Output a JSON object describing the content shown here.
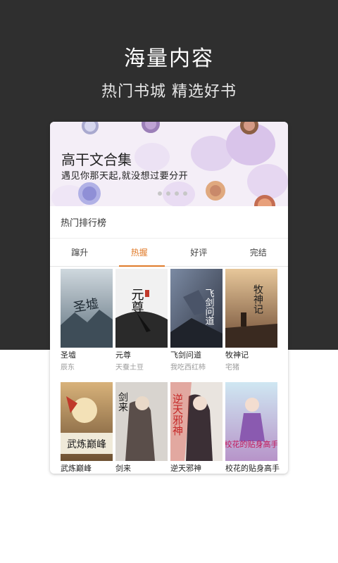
{
  "hero": {
    "title": "海量内容",
    "subtitle": "热门书城  精选好书"
  },
  "banner": {
    "title": "高干文合集",
    "subtitle": "遇见你那天起,就没想过要分开"
  },
  "ranking": {
    "section_title": "热门排行榜",
    "tabs": [
      {
        "label": "蹿升"
      },
      {
        "label": "热握"
      },
      {
        "label": "好评"
      },
      {
        "label": "完结"
      }
    ],
    "active_tab": "热握",
    "accent_color": "#e07b2a"
  },
  "books": [
    {
      "title": "圣墟",
      "author": "辰东",
      "cover_text": "圣墟"
    },
    {
      "title": "元尊",
      "author": "天蚕土豆",
      "cover_text": "元尊"
    },
    {
      "title": "飞剑问道",
      "author": "我吃西红柿",
      "cover_text": "飞剑问道"
    },
    {
      "title": "牧神记",
      "author": "宅猪",
      "cover_text": "牧神记"
    },
    {
      "title": "武炼巅峰",
      "author": "",
      "cover_text": "武炼巅峰"
    },
    {
      "title": "剑来",
      "author": "",
      "cover_text": "剑来"
    },
    {
      "title": "逆天邪神",
      "author": "",
      "cover_text": "逆天邪神"
    },
    {
      "title": "校花的贴身高手",
      "author": "",
      "cover_text": "校花的贴身高手"
    }
  ]
}
